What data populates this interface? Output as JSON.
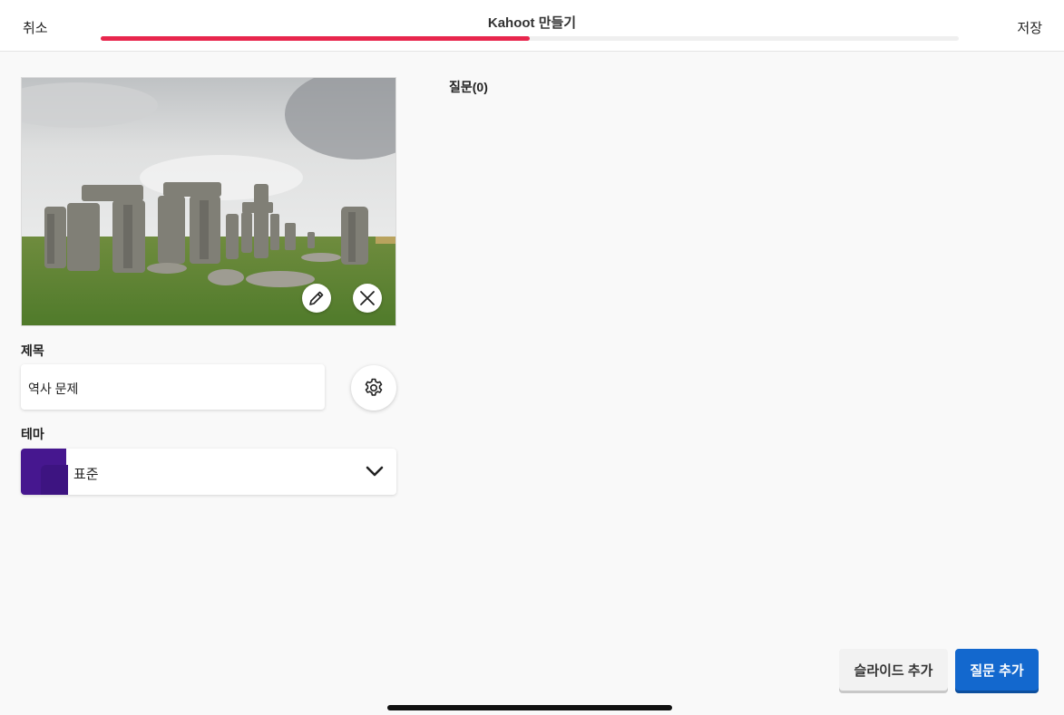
{
  "header": {
    "cancel_label": "취소",
    "title": "Kahoot 만들기",
    "save_label": "저장",
    "progress_percent": 50,
    "progress_color": "#e8264d"
  },
  "cover_image": {
    "edit_icon": "pencil-icon",
    "remove_icon": "close-icon"
  },
  "form": {
    "title_label": "제목",
    "title_value": "역사 문제",
    "settings_icon": "gear-icon",
    "theme_label": "테마",
    "theme_value": "표준",
    "theme_color": "#46178f",
    "theme_dropdown_icon": "chevron-down-icon"
  },
  "questions": {
    "heading": "질문(0)"
  },
  "actions": {
    "add_slide_label": "슬라이드 추가",
    "add_question_label": "질문 추가",
    "primary_color": "#1368ce"
  }
}
